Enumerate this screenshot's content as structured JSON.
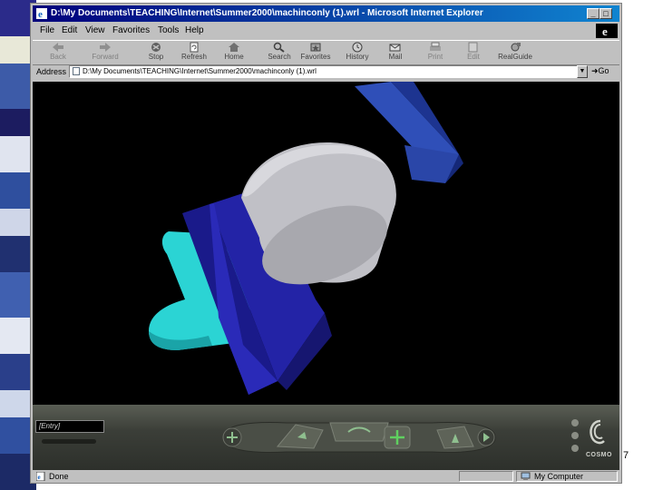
{
  "window": {
    "title": "D:\\My Documents\\TEACHING\\Internet\\Summer2000\\machinconly (1).wrl - Microsoft Internet Explorer",
    "minimize": "_",
    "maximize": "□",
    "close": "×"
  },
  "menu": {
    "items": [
      {
        "label": "File"
      },
      {
        "label": "Edit"
      },
      {
        "label": "View"
      },
      {
        "label": "Favorites"
      },
      {
        "label": "Tools"
      },
      {
        "label": "Help"
      }
    ]
  },
  "toolbar": {
    "buttons": [
      {
        "label": "Back",
        "icon": "back-arrow-icon"
      },
      {
        "label": "Forward",
        "icon": "forward-arrow-icon"
      },
      {
        "label": "Stop",
        "icon": "stop-icon"
      },
      {
        "label": "Refresh",
        "icon": "refresh-icon"
      },
      {
        "label": "Home",
        "icon": "home-icon"
      },
      {
        "label": "Search",
        "icon": "search-icon"
      },
      {
        "label": "Favorites",
        "icon": "favorites-icon"
      },
      {
        "label": "History",
        "icon": "history-icon"
      },
      {
        "label": "Mail",
        "icon": "mail-icon"
      },
      {
        "label": "Print",
        "icon": "print-icon"
      },
      {
        "label": "Edit",
        "icon": "edit-icon"
      },
      {
        "label": "RealGuide",
        "icon": "realguide-icon"
      }
    ]
  },
  "address": {
    "label": "Address",
    "value": "D:\\My Documents\\TEACHING\\Internet\\Summer2000\\machinconly (1).wrl",
    "go_label": "Go"
  },
  "cosmo": {
    "viewpoint": "[Entry]",
    "brand": "COSMO"
  },
  "status": {
    "text": "Done",
    "zone": "My Computer"
  },
  "slide": {
    "page_number": "7"
  },
  "colors": {
    "titlebar_start": "#00007b",
    "viewport_bg": "#000000",
    "block_blue": "#2525a0",
    "cylinder_gray": "#bfbfbf",
    "cyan_part": "#2cd6d6"
  }
}
